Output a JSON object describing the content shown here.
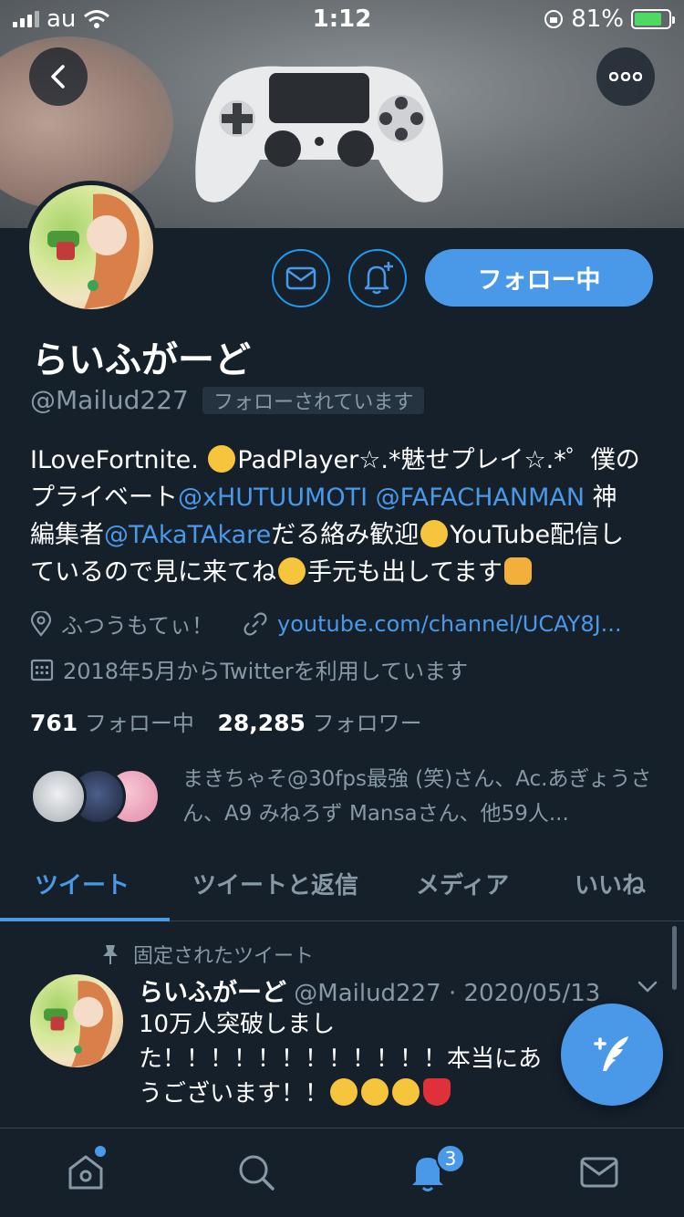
{
  "status_bar": {
    "carrier": "au",
    "time": "1:12",
    "battery_percent": "81%",
    "battery_level": 0.81
  },
  "profile": {
    "display_name": "らいふがーど",
    "handle": "@Mailud227",
    "follows_you": "フォローされています",
    "follow_button": "フォロー中",
    "bio": {
      "line1_text": "ILoveFortnite.",
      "line1_rest": "PadPlayer☆.*魅せプレイ☆.*゜僕の",
      "line2_text": "プライベート",
      "mention1": "@xHUTUUMOTI",
      "mention2": "@FAFACHANMAN",
      "line2_rest": "神",
      "line3_text": "編集者",
      "mention3": "@TAkaTAkare",
      "line3_mid": "だる絡み歓迎",
      "line3_rest": "YouTube配信し",
      "line4_text": "ているので見に来てね",
      "line4_rest": "手元も出してます"
    },
    "location": "ふつうもてぃ！",
    "website": "youtube.com/channel/UCAY8J...",
    "joined": "2018年5月からTwitterを利用しています",
    "following_count": "761",
    "following_label": "フォロー中",
    "followers_count": "28,285",
    "followers_label": "フォロワー",
    "known_followers": "まきちゃそ@30fps最強 (笑)さん、Ac.あぎょうさん、A9 みねろず Mansaさん、他59人..."
  },
  "tabs": [
    "ツイート",
    "ツイートと返信",
    "メディア",
    "いいね"
  ],
  "pinned_tweet": {
    "pinned_label": "固定されたツイート",
    "author": "らいふがーど",
    "handle_date": "@Mailud227 · 2020/05/13",
    "line1": "10万人突破しまし",
    "line2": "た！！！！！！！！！！！！本当にあ",
    "line3": "うございます！！"
  },
  "nav": {
    "notifications_badge": "3"
  },
  "colors": {
    "background": "#15202b",
    "accent": "#4a99e9",
    "muted": "#8899a6"
  }
}
